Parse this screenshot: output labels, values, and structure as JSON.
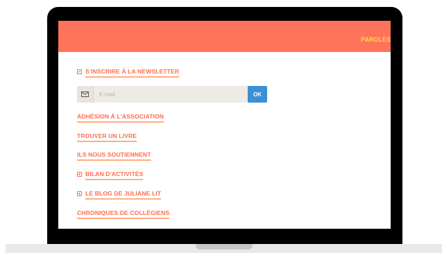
{
  "header": {
    "nav_link": "PAROLES"
  },
  "menu": {
    "newsletter": "S'INSCRIRE À LA NEWSLETTER",
    "items": [
      {
        "label": "ADHÉSION À L'ASSOCIATION"
      },
      {
        "label": "TROUVER UN LIVRE"
      },
      {
        "label": "ILS NOUS SOUTIENNENT"
      },
      {
        "label": "BILAN D'ACTIVITÉS",
        "icon": "plus-square-icon"
      },
      {
        "label": "LE BLOG DE JULIANE LIT",
        "icon": "plus-square-icon"
      },
      {
        "label": "CHRONIQUES DE COLLÉGIENS"
      }
    ]
  },
  "newsletter_form": {
    "email_placeholder": "E-mail",
    "submit_label": "OK",
    "icon": "envelope-icon"
  },
  "colors": {
    "header_bg": "#ff735a",
    "nav_link": "#ffd84a",
    "menu_text": "#ff6b4f",
    "menu_underline": "#ffae7f",
    "ok_button": "#3b8fd6",
    "input_bg": "#eeebe4"
  }
}
